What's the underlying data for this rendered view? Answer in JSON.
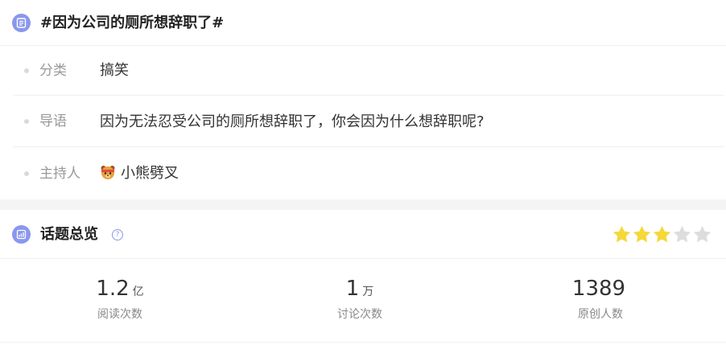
{
  "topic": {
    "title": "#因为公司的厕所想辞职了#",
    "icon": "document-list-icon"
  },
  "details": [
    {
      "label": "分类",
      "value": "搞笑"
    },
    {
      "label": "导语",
      "value": "因为无法忍受公司的厕所想辞职了，你会因为什么想辞职呢?"
    },
    {
      "label": "主持人",
      "value": "小熊劈叉",
      "icon": "bear-avatar-icon"
    }
  ],
  "overview": {
    "title": "话题总览",
    "help": "?",
    "rating": 3,
    "rating_max": 5,
    "star_on_color": "#f5d83a",
    "star_off_color": "#dddddd",
    "stats": [
      {
        "number": "1.2",
        "unit": "亿",
        "label": "阅读次数"
      },
      {
        "number": "1",
        "unit": "万",
        "label": "讨论次数"
      },
      {
        "number": "1389",
        "unit": "",
        "label": "原创人数"
      }
    ]
  },
  "colors": {
    "accent": "#8a97ee"
  }
}
